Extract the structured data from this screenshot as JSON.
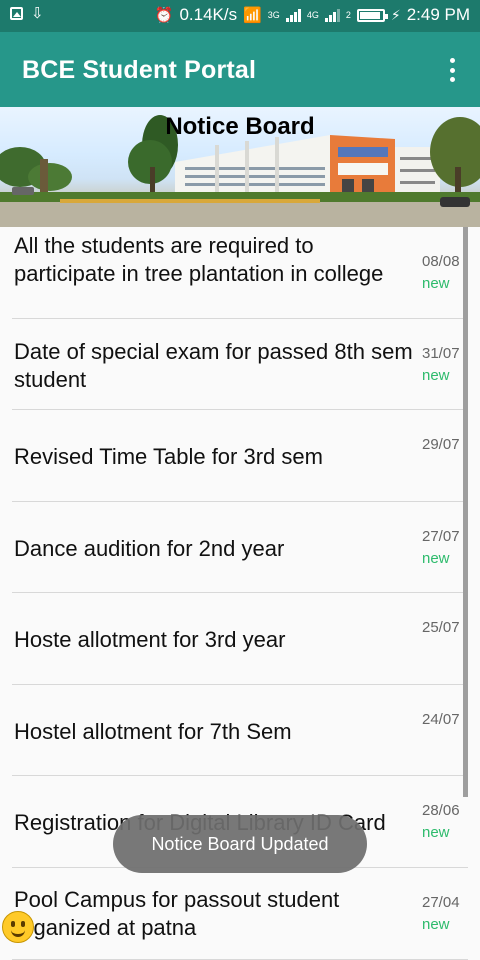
{
  "status_bar": {
    "speed": "0.14K/s",
    "net1": "3G",
    "net2": "4G",
    "sim": "2",
    "time": "2:49 PM"
  },
  "app_bar": {
    "title": "BCE Student Portal",
    "menu_icon": "more-vert-icon"
  },
  "banner": {
    "title": "Notice Board"
  },
  "notices": [
    {
      "title": "All the students are required to participate in tree plantation in college",
      "date": "08/08",
      "badge": "new"
    },
    {
      "title": "Date of special exam for passed 8th sem student",
      "date": "31/07",
      "badge": "new"
    },
    {
      "title": "Revised Time Table for 3rd sem",
      "date": "29/07",
      "badge": ""
    },
    {
      "title": "Dance audition for 2nd year",
      "date": "27/07",
      "badge": "new"
    },
    {
      "title": "Hoste allotment for 3rd year",
      "date": "25/07",
      "badge": ""
    },
    {
      "title": "Hostel allotment for 7th Sem",
      "date": "24/07",
      "badge": ""
    },
    {
      "title": "Registration for Digital Library ID Card",
      "date": "28/06",
      "badge": "new"
    },
    {
      "title": "Pool Campus for passout student organized at patna",
      "date": "27/04",
      "badge": "new"
    }
  ],
  "toast": {
    "message": "Notice Board Updated"
  },
  "colors": {
    "status_bar": "#1d7a6c",
    "app_bar": "#26978a",
    "new_badge": "#2dbb6c"
  }
}
